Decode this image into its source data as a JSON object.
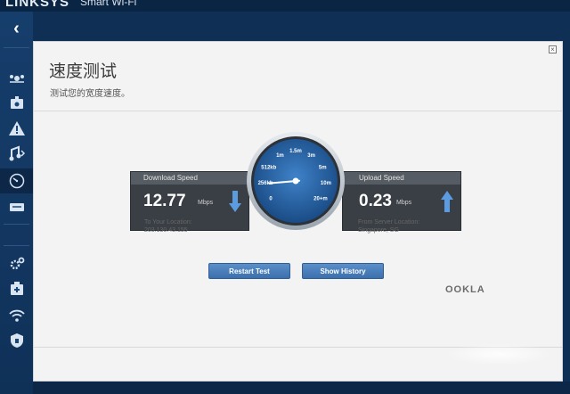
{
  "app": {
    "brand": "LINKSYS",
    "product": "Smart Wi-Fi"
  },
  "sidebar": {
    "back_icon": "back-chevron-icon",
    "items": [
      {
        "icon": "devices-icon"
      },
      {
        "icon": "parental-controls-icon"
      },
      {
        "icon": "warning-icon"
      },
      {
        "icon": "media-prioritization-icon"
      },
      {
        "icon": "speed-test-icon",
        "active": true
      },
      {
        "icon": "external-storage-icon"
      },
      {
        "icon": "connectivity-settings-icon"
      },
      {
        "icon": "troubleshooting-icon"
      },
      {
        "icon": "wireless-icon"
      },
      {
        "icon": "security-icon"
      }
    ]
  },
  "page": {
    "title": "速度测试",
    "subtitle": "测试您的宽度速度。"
  },
  "download": {
    "label": "Download Speed",
    "value": "12.77",
    "unit": "Mbps",
    "location_label": "To Your Location:",
    "location_value": "203.130.43.155"
  },
  "upload": {
    "label": "Upload Speed",
    "value": "0.23",
    "unit": "Mbps",
    "location_label": "From Server Location:",
    "location_value": "Singapore, SG"
  },
  "gauge": {
    "ticks": [
      "0",
      "256kb",
      "512kb",
      "1m",
      "1.5m",
      "3m",
      "5m",
      "10m",
      "20+m"
    ],
    "needle_fraction": 0.12
  },
  "buttons": {
    "restart": "Restart Test",
    "history": "Show History"
  },
  "ookla": "OOKLA",
  "colors": {
    "accent": "#3b70ad",
    "panel_dark": "#3a3f45",
    "sidebar": "#163e6c"
  }
}
